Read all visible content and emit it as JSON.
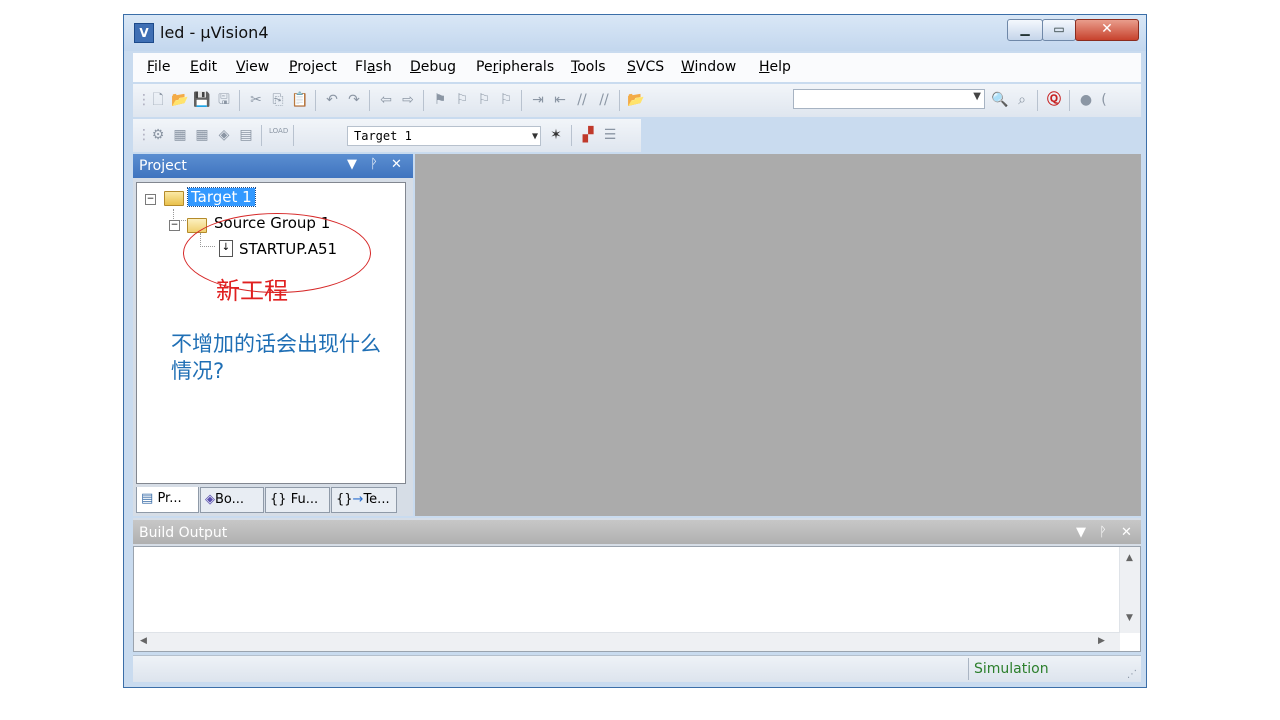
{
  "window": {
    "title": "led  - µVision4",
    "app_icon": "uv-logo-icon"
  },
  "menubar": {
    "items": [
      {
        "label": "File",
        "mnemonic": "F"
      },
      {
        "label": "Edit",
        "mnemonic": "E"
      },
      {
        "label": "View",
        "mnemonic": "V"
      },
      {
        "label": "Project",
        "mnemonic": "P"
      },
      {
        "label": "Flash",
        "mnemonic": "a"
      },
      {
        "label": "Debug",
        "mnemonic": "D"
      },
      {
        "label": "Peripherals",
        "mnemonic": "r"
      },
      {
        "label": "Tools",
        "mnemonic": "T"
      },
      {
        "label": "SVCS",
        "mnemonic": "S"
      },
      {
        "label": "Window",
        "mnemonic": "W"
      },
      {
        "label": "Help",
        "mnemonic": "H"
      }
    ]
  },
  "toolbar2": {
    "target_select": "Target 1",
    "load_label": "LOAD"
  },
  "project_panel": {
    "title": "Project",
    "tree": {
      "target": "Target 1",
      "group": "Source Group 1",
      "file": "STARTUP.A51"
    },
    "tabs": [
      "Pr...",
      "Bo...",
      "Fu...",
      "Te..."
    ]
  },
  "annotations": {
    "new_project": "新工程",
    "question": "不增加的话会出现什么情况?"
  },
  "build_output": {
    "title": "Build Output"
  },
  "statusbar": {
    "mode": "Simulation"
  },
  "colors": {
    "annotation_red": "#e02020",
    "annotation_blue": "#1f6fb5",
    "selection": "#3399ff"
  }
}
